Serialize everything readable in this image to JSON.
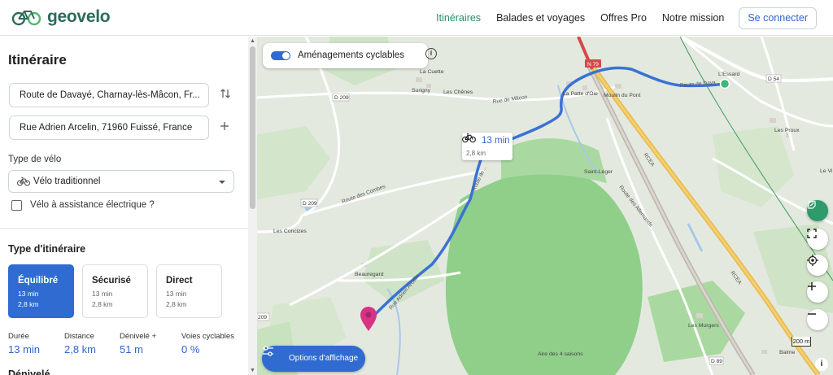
{
  "header": {
    "brand": "geovelo",
    "nav": [
      "Itinéraires",
      "Balades et voyages",
      "Offres Pro",
      "Notre mission"
    ],
    "active_nav": "Itinéraires",
    "connect_label": "Se connecter",
    "brand_color": "#2c6b5a",
    "active_color": "#2e8b66"
  },
  "sidebar": {
    "title": "Itinéraire",
    "origin": "Route de Davayé, Charnay-lès-Mâcon, Fr...",
    "destination": "Rue Adrien Arcelin, 71960 Fuissé, France",
    "bike_type_label": "Type de vélo",
    "bike_type_value": "Vélo traditionnel",
    "ebike_label": "Vélo à assistance électrique ?",
    "ebike_checked": false,
    "route_type_label": "Type d'itinéraire",
    "options": [
      {
        "name": "Équilibré",
        "time": "13 min",
        "distance": "2,8 km",
        "selected": true
      },
      {
        "name": "Sécurisé",
        "time": "13 min",
        "distance": "2,8 km",
        "selected": false
      },
      {
        "name": "Direct",
        "time": "13 min",
        "distance": "2,8 km",
        "selected": false
      }
    ],
    "stats": [
      {
        "label": "Durée",
        "value": "13 min"
      },
      {
        "label": "Distance",
        "value": "2,8 km"
      },
      {
        "label": "Dénivelé +",
        "value": "51 m"
      },
      {
        "label": "Voies cyclables",
        "value": "0 %"
      }
    ],
    "next_heading": "Dénivelé"
  },
  "map": {
    "layer_toggle_label": "Aménagements cyclables",
    "layer_toggle_on": true,
    "route_time": "13 min",
    "route_distance": "2,8 km",
    "options_button": "Options d'affichage",
    "scale_label": "200 m",
    "attribution": "i",
    "route_color": "#3a72d6",
    "places": [
      "L'Essard",
      "Les Proux",
      "La Cuette",
      "Surigny",
      "Les Chênes",
      "La Patte d'Oie",
      "Moulin du Pont",
      "Saint-Léger",
      "Les Concizes",
      "Beauregard",
      "Les Murgers",
      "Balme",
      "Aire des 4 saisons",
      "Le Vi"
    ],
    "roads": [
      "N 79",
      "D 54",
      "D 209",
      "D 209",
      "209",
      "D 89",
      "RCEA",
      "RCEA",
      "Route de Dava",
      "Rue de Mâcon",
      "Route des Combes",
      "Route de...",
      "Rue Adrien Arcelin",
      "Route des Allemands"
    ]
  }
}
